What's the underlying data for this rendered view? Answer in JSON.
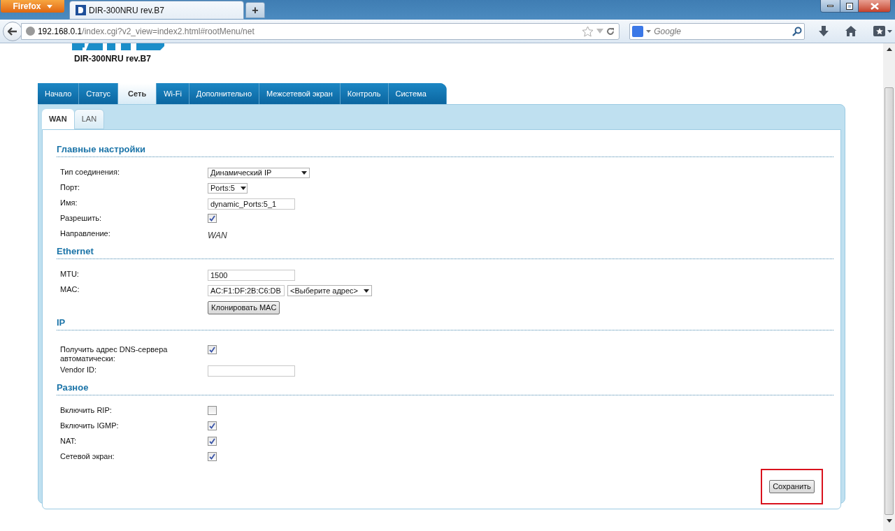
{
  "browser": {
    "app_button": "Firefox",
    "tab_title": "DIR-300NRU rev.B7",
    "new_tab": "+",
    "address_host": "192.168.0.1",
    "address_path": "/index.cgi?v2_view=index2.html#rootMenu/net",
    "search_placeholder": "Google"
  },
  "model": "DIR-300NRU rev.B7",
  "main_tabs": [
    {
      "label": "Начало",
      "selected": false
    },
    {
      "label": "Статус",
      "selected": false
    },
    {
      "label": "Сеть",
      "selected": true
    },
    {
      "label": "Wi-Fi",
      "selected": false
    },
    {
      "label": "Дополнительно",
      "selected": false
    },
    {
      "label": "Межсетевой экран",
      "selected": false
    },
    {
      "label": "Контроль",
      "selected": false
    },
    {
      "label": "Система",
      "selected": false
    }
  ],
  "sub_tabs": [
    {
      "label": "WAN",
      "selected": true
    },
    {
      "label": "LAN",
      "selected": false
    }
  ],
  "sections": [
    {
      "title": "Главные настройки",
      "rows": [
        {
          "kind": "select",
          "label": "Тип соединения:",
          "value": "Динамический IP",
          "wide": true
        },
        {
          "kind": "select",
          "label": "Порт:",
          "value": "Ports:5",
          "wide": false
        },
        {
          "kind": "input",
          "label": "Имя:",
          "value": "dynamic_Ports:5_1"
        },
        {
          "kind": "checkbox",
          "label": "Разрешить:",
          "checked": true
        },
        {
          "kind": "static",
          "label": "Направление:",
          "value": "WAN"
        }
      ]
    },
    {
      "title": "Ethernet",
      "rows": [
        {
          "kind": "input",
          "label": "MTU:",
          "value": "1500"
        },
        {
          "kind": "mac",
          "label": "MAC:",
          "value": "AC:F1:DF:2B:C6:DB",
          "select": "<Выберите адрес>"
        },
        {
          "kind": "button",
          "value": "Клонировать MAC"
        }
      ]
    },
    {
      "title": "IP",
      "rows": [
        {
          "kind": "checkbox",
          "label": "Получить адрес DNS-сервера автоматически:",
          "checked": true
        },
        {
          "kind": "input",
          "label": "Vendor ID:"
        }
      ]
    },
    {
      "title": "Разное",
      "rows": [
        {
          "kind": "checkbox",
          "label": "Включить RIP:",
          "checked": false
        },
        {
          "kind": "checkbox",
          "label": "Включить IGMP:",
          "checked": true
        },
        {
          "kind": "checkbox",
          "label": "NAT:",
          "checked": true
        },
        {
          "kind": "checkbox",
          "label": "Сетевой экран:",
          "checked": true
        }
      ]
    }
  ],
  "save_button": {
    "label": "Сохранить",
    "highlighted": true
  }
}
